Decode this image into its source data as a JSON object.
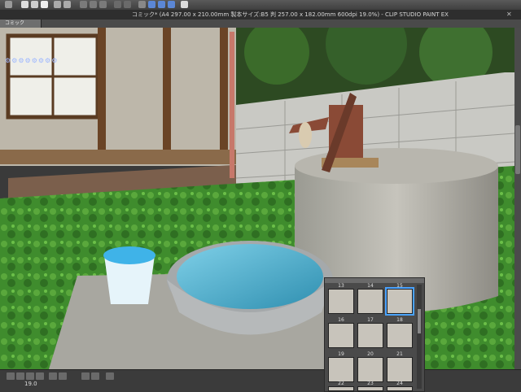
{
  "window": {
    "title": "コミック* (A4 297.00 x 210.00mm 製本サイズ:B5 判 257.00 x 182.00mm 600dpi 19.0%) - CLIP STUDIO PAINT EX",
    "close_glyph": "✕"
  },
  "tabs": [
    {
      "label": "コミック"
    }
  ],
  "status": {
    "zoom": "19.0"
  },
  "thumbnail_panel": {
    "items": [
      {
        "num": "13"
      },
      {
        "num": "14"
      },
      {
        "num": "15",
        "selected": true
      },
      {
        "num": "16"
      },
      {
        "num": "17"
      },
      {
        "num": "18"
      },
      {
        "num": "19"
      },
      {
        "num": "20"
      },
      {
        "num": "21"
      },
      {
        "num": "22"
      },
      {
        "num": "23"
      },
      {
        "num": "24"
      }
    ]
  },
  "colors": {
    "accent": "#4aa3ff",
    "ui_dark": "#3b3b3b"
  }
}
